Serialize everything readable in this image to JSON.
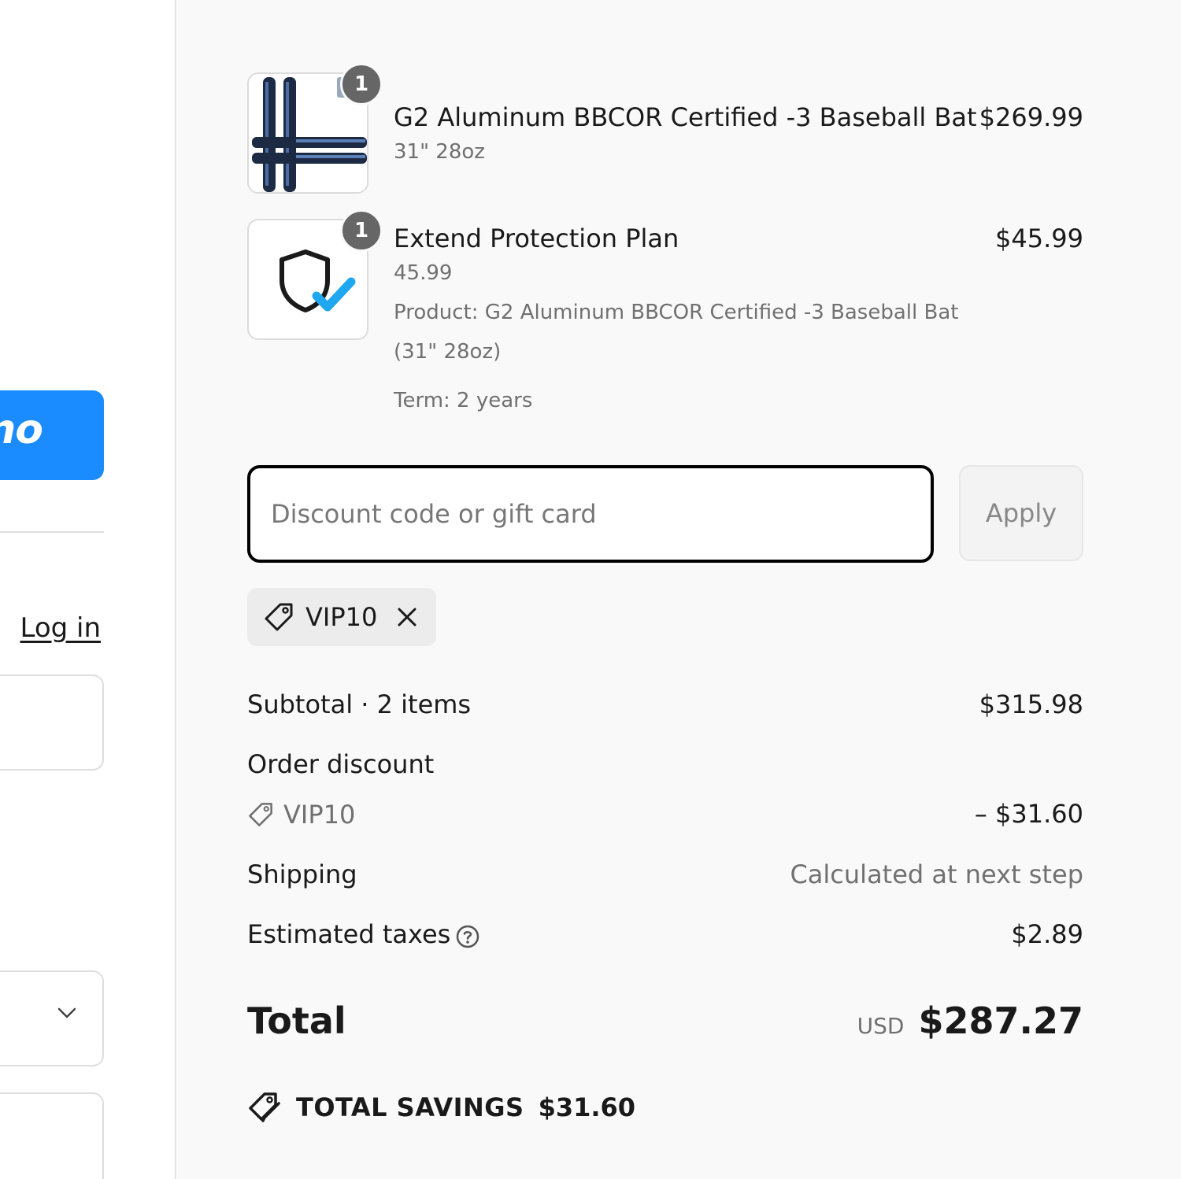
{
  "left": {
    "express_button_text": "no",
    "login_link": "Log in"
  },
  "items": [
    {
      "title": "G2 Aluminum BBCOR Certified -3 Baseball Bat",
      "variant": "31\" 28oz",
      "price": "$269.99",
      "quantity": "1",
      "thumbnail_icon": "baseball-bat-image"
    },
    {
      "title": "Extend Protection Plan",
      "variant": "45.99",
      "product_line1": "Product: G2 Aluminum BBCOR Certified -3 Baseball Bat",
      "product_line2": "(31\" 28oz)",
      "term": "Term: 2 years",
      "price": "$45.99",
      "quantity": "1",
      "thumbnail_icon": "shield-check-icon"
    }
  ],
  "discount": {
    "placeholder": "Discount code or gift card",
    "apply_label": "Apply",
    "applied_code": "VIP10"
  },
  "totals": {
    "subtotal_label": "Subtotal · 2 items",
    "subtotal_value": "$315.98",
    "order_discount_label": "Order discount",
    "order_discount_code": "VIP10",
    "order_discount_value": "– $31.60",
    "shipping_label": "Shipping",
    "shipping_value": "Calculated at next step",
    "taxes_label": "Estimated taxes",
    "taxes_value": "$2.89",
    "total_label": "Total",
    "currency": "USD",
    "total_value": "$287.27",
    "savings_label": "TOTAL SAVINGS",
    "savings_value": "$31.60"
  },
  "colors": {
    "accent_blue": "#1a8cff",
    "check_blue": "#1fa8f0",
    "summary_bg": "#f9f9f9",
    "badge_gray": "#666666"
  }
}
